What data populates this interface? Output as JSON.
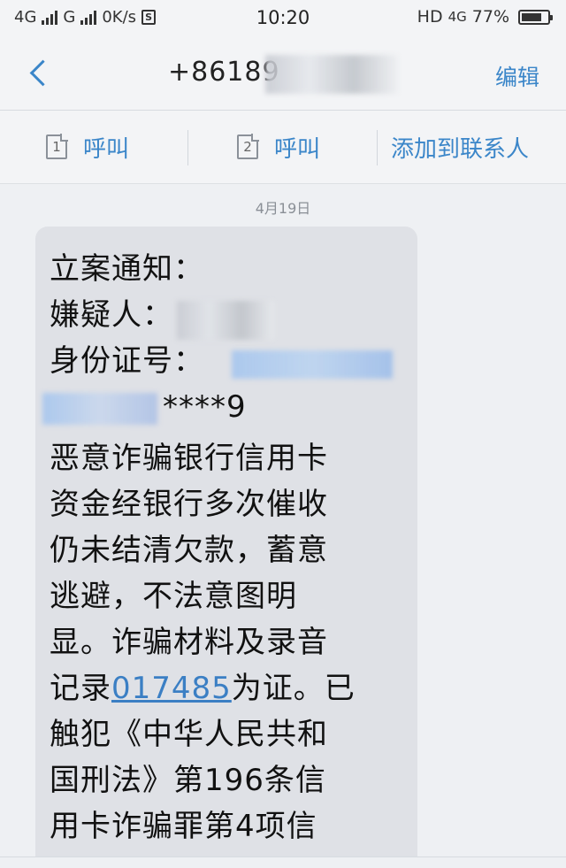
{
  "status_bar": {
    "net1": "4G",
    "net2": "G",
    "speed": "0K/s",
    "sim_badge": "S",
    "time": "10:20",
    "hd": "HD",
    "net_right": "4G",
    "battery": "77%",
    "battery_level": 0.77
  },
  "header": {
    "title": "+86189",
    "edit_label": "编辑"
  },
  "actions": {
    "call1_sim": "1",
    "call1_label": "呼叫",
    "call2_sim": "2",
    "call2_label": "呼叫",
    "add_contact_label": "添加到联系人"
  },
  "conversation": {
    "date": "4月19日",
    "message_lines": [
      "立案通知：",
      "嫌疑人：",
      "身份证号：",
      "****9",
      "恶意诈骗银行信用卡",
      "资金经银行多次催收",
      "仍未结清欠款，蓄意",
      "逃避，不法意图明",
      "显。诈骗材料及录音",
      "为证。已",
      "触犯《中华人民共和",
      "国刑法》第196条信",
      "用卡诈骗罪第4项信"
    ],
    "record_prefix": "记录",
    "record_link": "017485"
  }
}
